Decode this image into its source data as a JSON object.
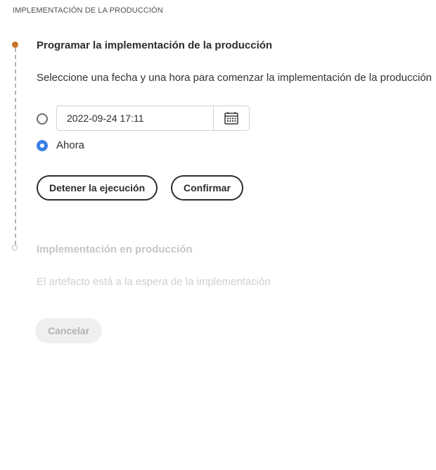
{
  "section": {
    "title": "IMPLEMENTACIÓN DE LA PRODUCCIÓN"
  },
  "steps": [
    {
      "title": "Programar la implementación de la producción",
      "description": "Seleccione una fecha y una hora para comenzar la implementación de la producción",
      "status": "active",
      "options": [
        {
          "type": "datetime",
          "value": "2022-09-24 17:11",
          "selected": false
        },
        {
          "type": "now",
          "label": "Ahora",
          "selected": true
        }
      ],
      "buttons": {
        "stop": "Detener la ejecución",
        "confirm": "Confirmar"
      }
    },
    {
      "title": "Implementación en producción",
      "description": "El artefacto está a la espera de la implementación",
      "status": "pending",
      "buttons": {
        "cancel": "Cancelar"
      }
    }
  ],
  "colors": {
    "active_step": "#c8742a",
    "radio_selected": "#3b7fe6",
    "disabled_text": "#c6c6c6"
  },
  "icons": {
    "date_picker": "calendar-icon"
  }
}
